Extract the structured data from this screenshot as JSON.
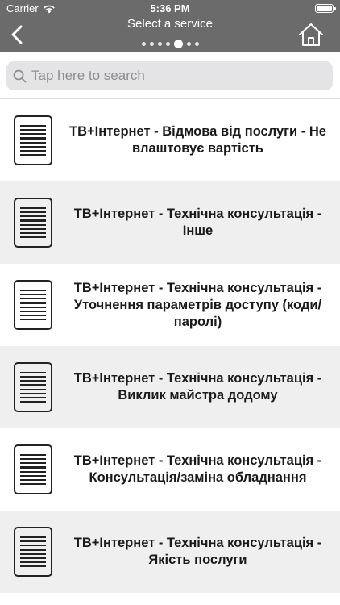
{
  "status_bar": {
    "carrier": "Carrier",
    "time": "5:36 PM",
    "icons": [
      "wifi-icon",
      "battery-icon"
    ]
  },
  "header": {
    "title": "Select a service",
    "back_icon": "chevron-left-icon",
    "home_icon": "home-icon",
    "page_dots_count": 7,
    "page_dots_active": 4
  },
  "search": {
    "placeholder": "Tap here to search",
    "value": "",
    "icon": "search-icon"
  },
  "services": [
    {
      "label": "ТВ+Інтернет - Відмова від послуги - Не влаштовує вартість",
      "icon": "document-icon"
    },
    {
      "label": "ТВ+Інтернет - Технічна консультація - Інше",
      "icon": "document-icon"
    },
    {
      "label": "ТВ+Інтернет - Технічна консультація - Уточнення параметрів доступу (коди/паролі)",
      "icon": "document-icon"
    },
    {
      "label": "ТВ+Інтернет - Технічна консультація - Виклик майстра додому",
      "icon": "document-icon"
    },
    {
      "label": "ТВ+Інтернет - Технічна консультація - Консультація/заміна обладнання",
      "icon": "document-icon"
    },
    {
      "label": "ТВ+Інтернет - Технічна консультація - Якість послуги",
      "icon": "document-icon"
    }
  ],
  "colors": {
    "header_bg": "#6b6b6b",
    "row_alt_bg": "#efefef",
    "search_bg": "#e4e4e6"
  }
}
